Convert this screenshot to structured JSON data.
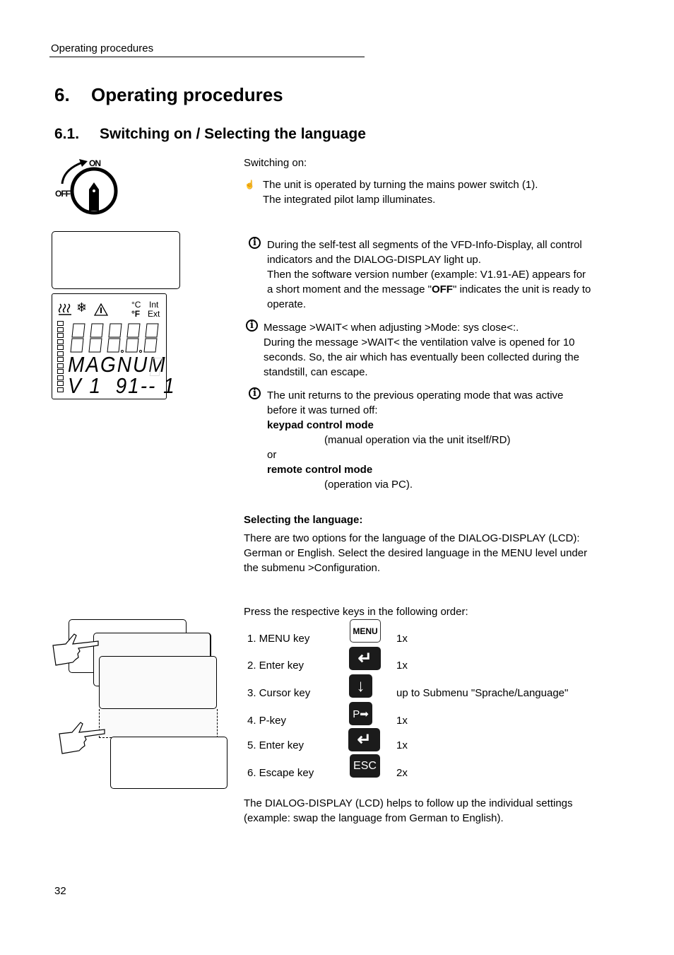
{
  "header": {
    "running_title": "Operating procedures"
  },
  "chapter": {
    "number": "6.",
    "title": "Operating procedures"
  },
  "section": {
    "number": "6.1.",
    "title": "Switching on / Selecting the language"
  },
  "switch_figure": {
    "on_label": "ON",
    "off_label": "OFF"
  },
  "vfd_display": {
    "temp_c": "°C",
    "temp_f": "°F",
    "int_label": "Int",
    "ext_label": "Ext",
    "line_magnum": "MAGNUM",
    "line_version": "V 1  91-- 1",
    "icons": [
      "heating-icon",
      "snowflake-icon",
      "warning-icon"
    ]
  },
  "switching_on": {
    "heading": "Switching on:",
    "bullet_line1": "The unit is operated by turning the mains power switch (1).",
    "bullet_line2": "The integrated pilot lamp illuminates."
  },
  "note_selftest": {
    "line1": "During the self-test all segments of the VFD-Info-Display, all control",
    "line2": "indicators and the DIALOG-DISPLAY light up.",
    "line3": "Then the software version number (example: V1.91-AE) appears for",
    "line4_pre": "a short moment and the message \"",
    "line4_bold": "OFF",
    "line4_post": "\" indicates the unit is ready to",
    "line5": "operate."
  },
  "note_wait": {
    "line1": "Message >WAIT< when adjusting  >Mode: sys close<:.",
    "line2": "During the message >WAIT< the ventilation valve is opened for 10",
    "line3": "seconds. So, the air  which has eventually been collected during the",
    "line4": "standstill, can escape."
  },
  "note_mode": {
    "line1": "The unit returns to the previous operating mode that was active",
    "line2": "before it was turned off:",
    "mode1_title": "keypad control mode",
    "mode1_desc": "(manual operation via the unit itself/RD)",
    "or": "or",
    "mode2_title": "remote control mode",
    "mode2_desc": "(operation via PC)."
  },
  "language": {
    "heading": "Selecting the language:",
    "line1": "There are two options for the language of the DIALOG-DISPLAY (LCD):",
    "line2": "German or English. Select the desired language in the MENU level under",
    "line3": "the submenu >Configuration.",
    "press_intro": "Press the respective keys in the following order:"
  },
  "steps": [
    {
      "label": "1.  MENU key",
      "key": "MENU",
      "icon": "menu-key-icon",
      "count": "1x"
    },
    {
      "label": "2.  Enter key",
      "key": "↵",
      "icon": "enter-key-icon",
      "count": "1x"
    },
    {
      "label": "3.  Cursor key",
      "key": "↓",
      "icon": "cursor-down-key-icon",
      "count": "up to Submenu \"Sprache/Language\""
    },
    {
      "label": "4.  P-key",
      "key": "P➡",
      "icon": "p-key-icon",
      "count": "1x"
    },
    {
      "label": "5.  Enter key",
      "key": "↵",
      "icon": "enter-key-icon",
      "count": "1x"
    },
    {
      "label": "6.  Escape key",
      "key": "ESC",
      "icon": "escape-key-icon",
      "count": "2x"
    }
  ],
  "closing": {
    "line1": "The DIALOG-DISPLAY (LCD) helps to follow up the individual settings",
    "line2": "(example: swap the language from German to English)."
  },
  "footer": {
    "page_number": "32"
  }
}
